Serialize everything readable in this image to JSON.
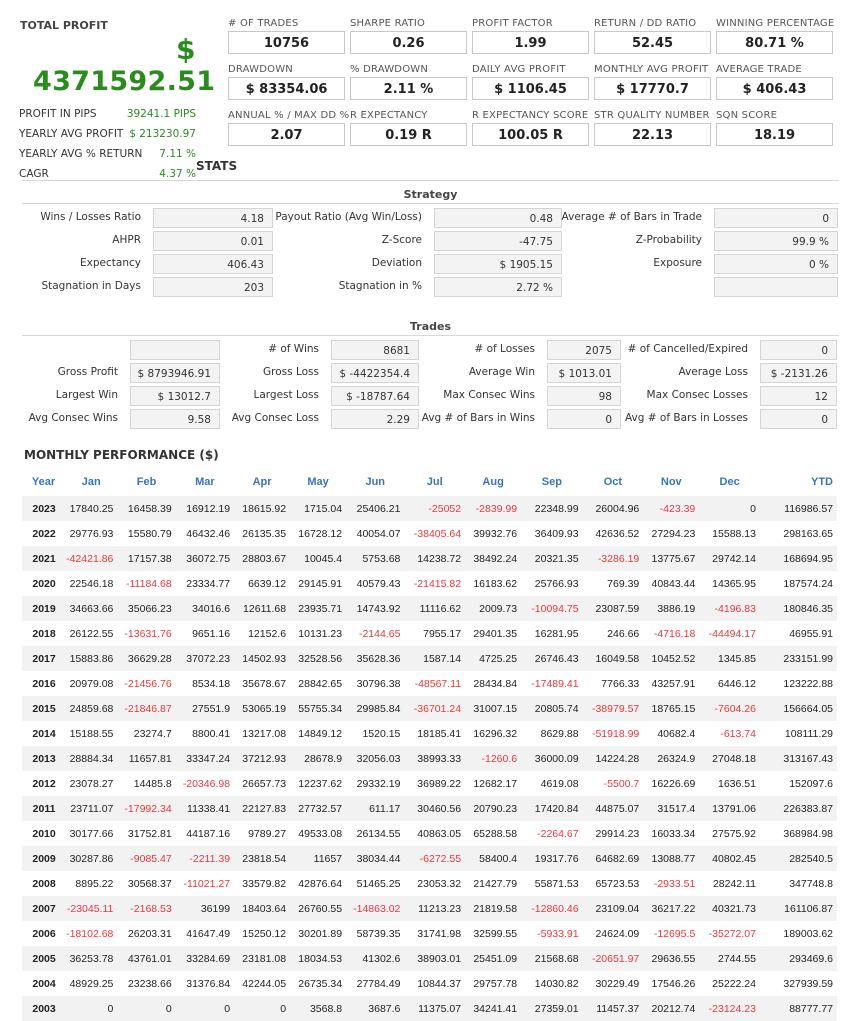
{
  "summary": {
    "title": "TOTAL PROFIT",
    "currency_symbol": "$",
    "total_profit": "4371592.51",
    "side": [
      {
        "label": "PROFIT IN PIPS",
        "value": "39241.1 PIPS"
      },
      {
        "label": "YEARLY AVG PROFIT",
        "value": "$ 213230.97"
      },
      {
        "label": "YEARLY AVG % RETURN",
        "value": "7.11 %"
      },
      {
        "label": "CAGR",
        "value": "4.37 %"
      }
    ],
    "stats_heading": "STATS"
  },
  "metrics": [
    {
      "label": "# OF TRADES",
      "value": "10756"
    },
    {
      "label": "SHARPE RATIO",
      "value": "0.26"
    },
    {
      "label": "PROFIT FACTOR",
      "value": "1.99"
    },
    {
      "label": "RETURN / DD RATIO",
      "value": "52.45"
    },
    {
      "label": "WINNING PERCENTAGE",
      "value": "80.71 %"
    },
    {
      "label": "DRAWDOWN",
      "value": "$ 83354.06"
    },
    {
      "label": "% DRAWDOWN",
      "value": "2.11 %"
    },
    {
      "label": "DAILY AVG PROFIT",
      "value": "$ 1106.45"
    },
    {
      "label": "MONTHLY AVG PROFIT",
      "value": "$ 17770.7"
    },
    {
      "label": "AVERAGE TRADE",
      "value": "$ 406.43"
    },
    {
      "label": "ANNUAL % / MAX DD %",
      "value": "2.07"
    },
    {
      "label": "R EXPECTANCY",
      "value": "0.19 R"
    },
    {
      "label": "R EXPECTANCY SCORE",
      "value": "100.05 R"
    },
    {
      "label": "STR QUALITY NUMBER",
      "value": "22.13"
    },
    {
      "label": "SQN SCORE",
      "value": "18.19"
    }
  ],
  "strategy": {
    "title": "Strategy",
    "rows": [
      [
        {
          "label": "Wins / Losses Ratio",
          "value": "4.18"
        },
        {
          "label": "Payout Ratio (Avg Win/Loss)",
          "value": "0.48"
        },
        {
          "label": "Average # of Bars in Trade",
          "value": "0"
        }
      ],
      [
        {
          "label": "AHPR",
          "value": "0.01"
        },
        {
          "label": "Z-Score",
          "value": "-47.75"
        },
        {
          "label": "Z-Probability",
          "value": "99.9 %"
        }
      ],
      [
        {
          "label": "Expectancy",
          "value": "406.43"
        },
        {
          "label": "Deviation",
          "value": "$ 1905.15"
        },
        {
          "label": "Exposure",
          "value": "0 %"
        }
      ],
      [
        {
          "label": "Stagnation in Days",
          "value": "203"
        },
        {
          "label": "Stagnation in %",
          "value": "2.72 %"
        },
        {
          "label": "",
          "value": ""
        }
      ]
    ]
  },
  "trades": {
    "title": "Trades",
    "rows": [
      [
        {
          "label": "",
          "value": ""
        },
        {
          "label": "# of Wins",
          "value": "8681"
        },
        {
          "label": "# of Losses",
          "value": "2075"
        },
        {
          "label": "# of Cancelled/Expired",
          "value": "0"
        }
      ],
      [
        {
          "label": "Gross Profit",
          "value": "$ 8793946.91"
        },
        {
          "label": "Gross Loss",
          "value": "$ -4422354.4"
        },
        {
          "label": "Average Win",
          "value": "$ 1013.01"
        },
        {
          "label": "Average Loss",
          "value": "$ -2131.26"
        }
      ],
      [
        {
          "label": "Largest Win",
          "value": "$ 13012.7"
        },
        {
          "label": "Largest Loss",
          "value": "$ -18787.64"
        },
        {
          "label": "Max Consec Wins",
          "value": "98"
        },
        {
          "label": "Max Consec Losses",
          "value": "12"
        }
      ],
      [
        {
          "label": "Avg Consec Wins",
          "value": "9.58"
        },
        {
          "label": "Avg Consec Loss",
          "value": "2.29"
        },
        {
          "label": "Avg # of Bars in Wins",
          "value": "0"
        },
        {
          "label": "Avg # of Bars in Losses",
          "value": "0"
        }
      ]
    ]
  },
  "monthly": {
    "title": "MONTHLY PERFORMANCE ($)",
    "headers": [
      "Year",
      "Jan",
      "Feb",
      "Mar",
      "Apr",
      "May",
      "Jun",
      "Jul",
      "Aug",
      "Sep",
      "Oct",
      "Nov",
      "Dec",
      "YTD"
    ],
    "rows": [
      [
        "2023",
        "17840.25",
        "16458.39",
        "16912.19",
        "18615.92",
        "1715.04",
        "25406.21",
        "-25052",
        "-2839.99",
        "22348.99",
        "26004.96",
        "-423.39",
        "0",
        "116986.57"
      ],
      [
        "2022",
        "29776.93",
        "15580.79",
        "46432.46",
        "26135.35",
        "16728.12",
        "40054.07",
        "-38405.64",
        "39932.76",
        "36409.93",
        "42636.52",
        "27294.23",
        "15588.13",
        "298163.65"
      ],
      [
        "2021",
        "-42421.86",
        "17157.38",
        "36072.75",
        "28803.67",
        "10045.4",
        "5753.68",
        "14238.72",
        "38492.24",
        "20321.35",
        "-3286.19",
        "13775.67",
        "29742.14",
        "168694.95"
      ],
      [
        "2020",
        "22546.18",
        "-11184.68",
        "23334.77",
        "6639.12",
        "29145.91",
        "40579.43",
        "-21415.82",
        "16183.62",
        "25766.93",
        "769.39",
        "40843.44",
        "14365.95",
        "187574.24"
      ],
      [
        "2019",
        "34663.66",
        "35066.23",
        "34016.6",
        "12611.68",
        "23935.71",
        "14743.92",
        "11116.62",
        "2009.73",
        "-10094.75",
        "23087.59",
        "3886.19",
        "-4196.83",
        "180846.35"
      ],
      [
        "2018",
        "26122.55",
        "-13631.76",
        "9651.16",
        "12152.6",
        "10131.23",
        "-2144.65",
        "7955.17",
        "29401.35",
        "16281.95",
        "246.66",
        "-4716.18",
        "-44494.17",
        "46955.91"
      ],
      [
        "2017",
        "15883.86",
        "36629.28",
        "37072.23",
        "14502.93",
        "32528.56",
        "35628.36",
        "1587.14",
        "4725.25",
        "26746.43",
        "16049.58",
        "10452.52",
        "1345.85",
        "233151.99"
      ],
      [
        "2016",
        "20979.08",
        "-21456.76",
        "8534.18",
        "35678.67",
        "28842.65",
        "30796.38",
        "-48567.11",
        "28434.84",
        "-17489.41",
        "7766.33",
        "43257.91",
        "6446.12",
        "123222.88"
      ],
      [
        "2015",
        "24859.68",
        "-21846.87",
        "27551.9",
        "53065.19",
        "55755.34",
        "29985.84",
        "-36701.24",
        "31007.15",
        "20805.74",
        "-38979.57",
        "18765.15",
        "-7604.26",
        "156664.05"
      ],
      [
        "2014",
        "15188.55",
        "23274.7",
        "8800.41",
        "13217.08",
        "14849.12",
        "1520.15",
        "18185.41",
        "16296.32",
        "8629.88",
        "-51918.99",
        "40682.4",
        "-613.74",
        "108111.29"
      ],
      [
        "2013",
        "28884.34",
        "11657.81",
        "33347.24",
        "37212.93",
        "28678.9",
        "32056.03",
        "38993.33",
        "-1260.6",
        "36000.09",
        "14224.28",
        "26324.9",
        "27048.18",
        "313167.43"
      ],
      [
        "2012",
        "23078.27",
        "14485.8",
        "-20346.98",
        "26657.73",
        "12237.62",
        "29332.19",
        "36989.22",
        "12682.17",
        "4619.08",
        "-5500.7",
        "16226.69",
        "1636.51",
        "152097.6"
      ],
      [
        "2011",
        "23711.07",
        "-17992.34",
        "11338.41",
        "22127.83",
        "27732.57",
        "611.17",
        "30460.56",
        "20790.23",
        "17420.84",
        "44875.07",
        "31517.4",
        "13791.06",
        "226383.87"
      ],
      [
        "2010",
        "30177.66",
        "31752.81",
        "44187.16",
        "9789.27",
        "49533.08",
        "26134.55",
        "40863.05",
        "65288.58",
        "-2264.67",
        "29914.23",
        "16033.34",
        "27575.92",
        "368984.98"
      ],
      [
        "2009",
        "30287.86",
        "-9085.47",
        "-2211.39",
        "23818.54",
        "11657",
        "38034.44",
        "-6272.55",
        "58400.4",
        "19317.76",
        "64682.69",
        "13088.77",
        "40802.45",
        "282540.5"
      ],
      [
        "2008",
        "8895.22",
        "30568.37",
        "-11021.27",
        "33579.82",
        "42876.64",
        "51465.25",
        "23053.32",
        "21427.79",
        "55871.53",
        "65723.53",
        "-2933.51",
        "28242.11",
        "347748.8"
      ],
      [
        "2007",
        "-23045.11",
        "-2168.53",
        "36199",
        "18403.64",
        "26760.55",
        "-14863.02",
        "11213.23",
        "21819.58",
        "-12860.46",
        "23109.04",
        "36217.22",
        "40321.73",
        "161106.87"
      ],
      [
        "2006",
        "-18102.68",
        "26203.31",
        "41647.49",
        "15250.12",
        "30201.89",
        "58739.35",
        "31741.98",
        "32599.55",
        "-5933.91",
        "24624.09",
        "-12695.5",
        "-35272.07",
        "189003.62"
      ],
      [
        "2005",
        "36253.78",
        "43761.01",
        "33284.69",
        "23181.08",
        "18034.53",
        "41302.6",
        "38903.01",
        "25451.09",
        "21568.68",
        "-20651.97",
        "29636.55",
        "2744.55",
        "293469.6"
      ],
      [
        "2004",
        "48929.25",
        "23238.66",
        "31376.84",
        "42244.05",
        "26735.34",
        "27784.49",
        "10844.37",
        "29757.78",
        "14030.82",
        "30229.49",
        "17546.26",
        "25222.24",
        "327939.59"
      ],
      [
        "2003",
        "0",
        "0",
        "0",
        "0",
        "3568.8",
        "3687.6",
        "11375.07",
        "34241.41",
        "27359.01",
        "11457.37",
        "20212.74",
        "-23124.23",
        "88777.77"
      ]
    ]
  },
  "colors": {
    "green": "#2a8c1f",
    "negative": "#e8383b",
    "header_blue": "#3a74b8"
  }
}
